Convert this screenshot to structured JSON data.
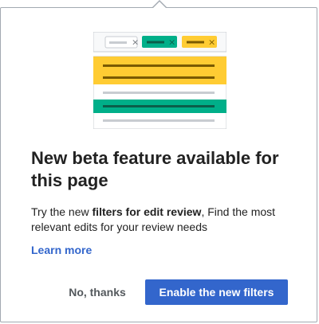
{
  "popup": {
    "title": "New beta feature available for this page",
    "desc_prefix": "Try the new ",
    "desc_bold": "filters for edit review",
    "desc_suffix": ", Find the most relevant edits for your  review needs",
    "learn_more": "Learn more",
    "dismiss_label": "No, thanks",
    "enable_label": "Enable the new filters",
    "illustration": {
      "chips": [
        {
          "color": "#c8ccd1",
          "close": "×"
        },
        {
          "color": "#00af89",
          "close": "×"
        },
        {
          "color": "#ffcc33",
          "close": "×"
        }
      ],
      "colors": {
        "yellow": "#ffcc33",
        "green": "#00af89",
        "line_dark": "#7a5a00",
        "line_green_dark": "#0b5e4a",
        "line_gray": "#c8ccd1",
        "border": "#c8ccd1"
      }
    }
  }
}
